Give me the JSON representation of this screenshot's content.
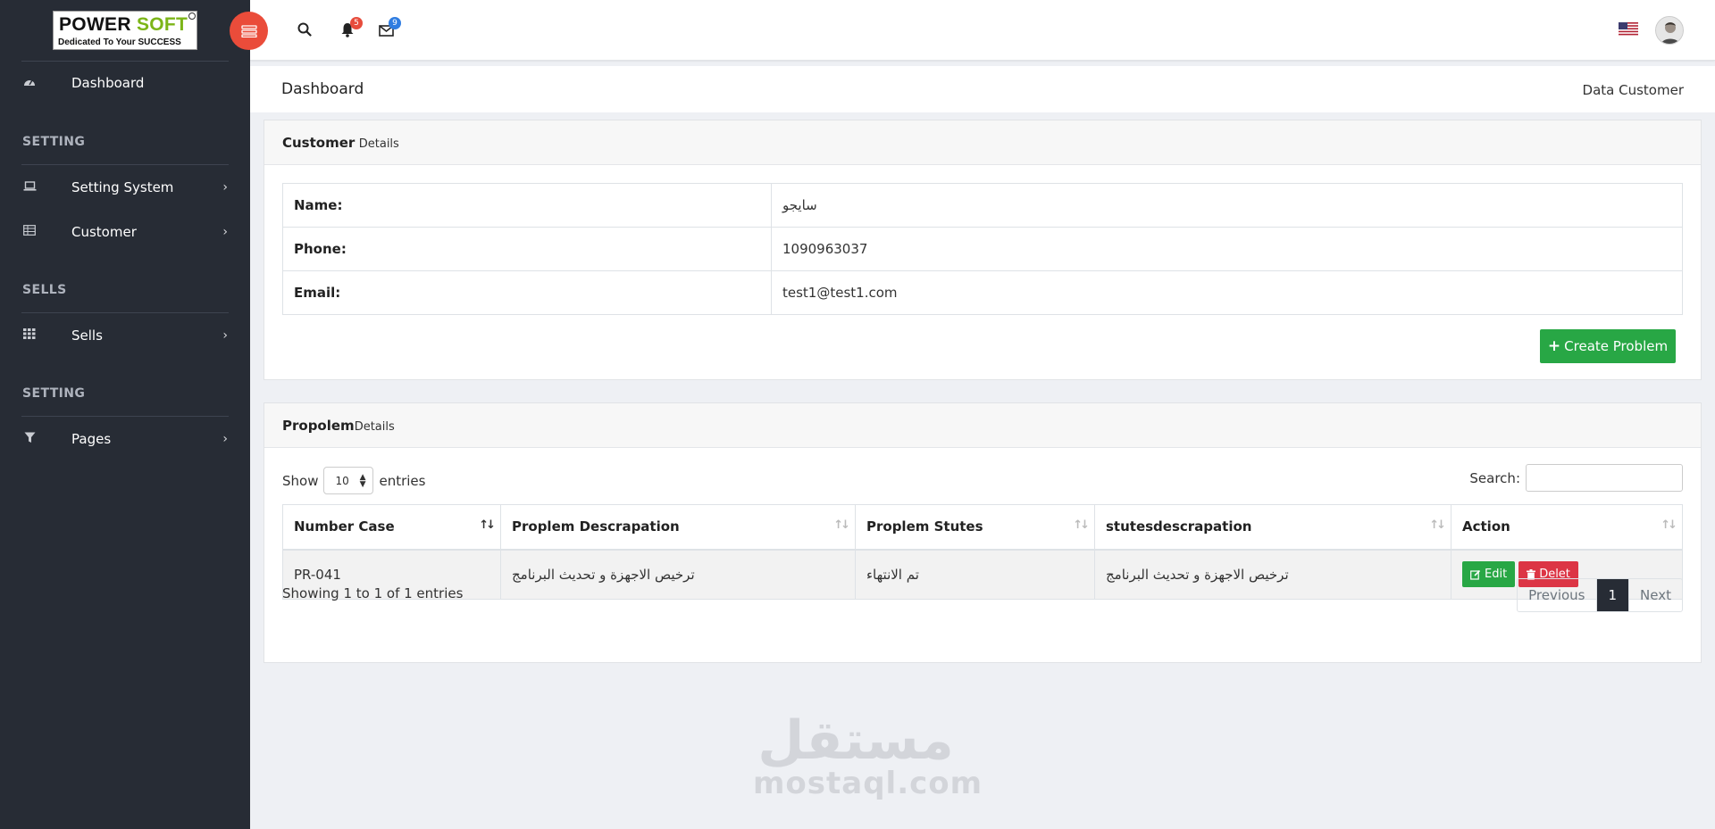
{
  "logo": {
    "brand_main": "POWER ",
    "brand_accent": "SOFT",
    "tagline": "Dedicated To Your SUCCESS"
  },
  "topbar": {
    "notifications_count": "5",
    "messages_count": "9",
    "notifications_badge_color": "#e74c3c",
    "messages_badge_color": "#2f7de1",
    "toggle_color": "#ea4c3a"
  },
  "sidebar": {
    "dashboard": "Dashboard",
    "section_setting": "SETTING",
    "setting_system": "Setting System",
    "customer": "Customer",
    "section_sells": "SELLS",
    "sells": "Sells",
    "section_setting2": "SETTING",
    "pages": "Pages"
  },
  "breadcrumb": {
    "title": "Dashboard",
    "right": "Data Customer"
  },
  "customer_card": {
    "title": "Customer",
    "subtitle": "Details",
    "rows": [
      {
        "label": "Name:",
        "value": "سايجو"
      },
      {
        "label": "Phone:",
        "value": "1090963037"
      },
      {
        "label": "Email:",
        "value": "test1@test1.com"
      }
    ],
    "create_button": "Create Problem"
  },
  "problem_card": {
    "title": "Propolem",
    "subtitle": "Details",
    "show_label": "Show",
    "entries_label": "entries",
    "page_size": "10",
    "search_label": "Search:",
    "search_value": "",
    "columns": [
      "Number Case",
      "Proplem Descrapation",
      "Proplem Stutes",
      "stutesdescrapation",
      "Action"
    ],
    "rows": [
      {
        "number": "PR-041",
        "description": "ترخيص الاجهزة و تحديث البرنامج",
        "status": "تم الانتهاء",
        "status_description": "ترخيص الاجهزة و تحديث البرنامج"
      }
    ],
    "edit_label": "Edit",
    "delete_label": "Delet",
    "showing_text": "Showing 1 to 1 of 1 entries",
    "pager": {
      "previous": "Previous",
      "current": "1",
      "next": "Next"
    }
  },
  "watermark": {
    "arabic": "مستقل",
    "latin": "mostaql.com"
  },
  "colors": {
    "sidebar_bg": "#272c35",
    "success": "#28a745",
    "danger": "#dc3545"
  }
}
